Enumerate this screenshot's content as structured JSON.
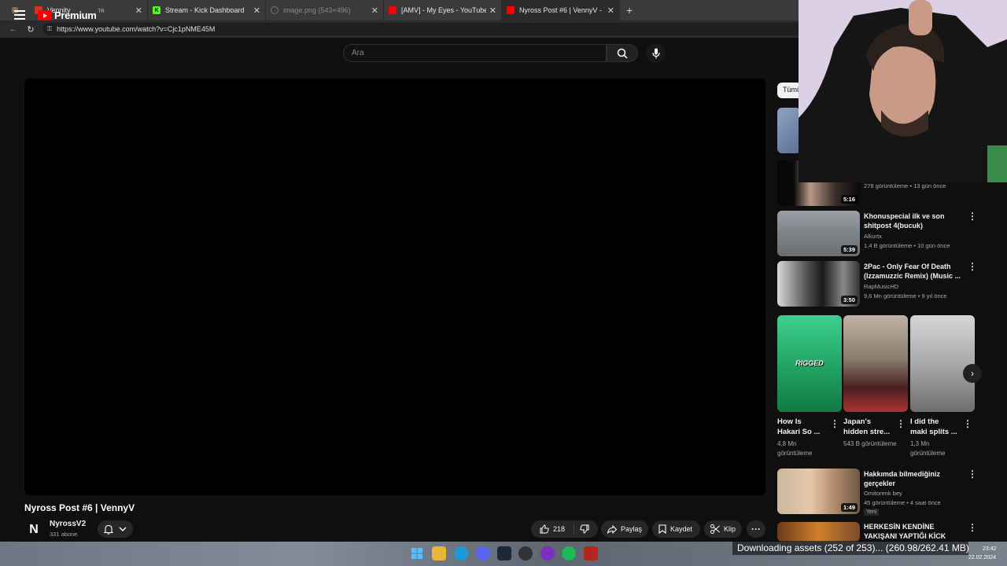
{
  "browser": {
    "tabs": [
      {
        "title": "Vennity",
        "icon": "vennity-icon",
        "color": "#d93025",
        "state": "normal"
      },
      {
        "title": "Stream - Kick Dashboard",
        "icon": "kick-icon",
        "color": "#53fc18",
        "state": "normal"
      },
      {
        "title": "image.png (543×496)",
        "icon": "globe-icon",
        "color": "#777777",
        "state": "dim"
      },
      {
        "title": "[AMV] - My Eyes - YouTube",
        "icon": "youtube-icon",
        "color": "#ff0000",
        "state": "normal"
      },
      {
        "title": "Nyross Post #6 | VennyV - YouTube",
        "icon": "youtube-icon",
        "color": "#ff0000",
        "state": "active"
      }
    ],
    "url": "https://www.youtube.com/watch?v=Cjc1pNME45M"
  },
  "youtube": {
    "logo_text": "Premium",
    "logo_region": "TR",
    "search_placeholder": "Ara"
  },
  "video": {
    "title": "Nyross Post #6 | VennyV",
    "channel": {
      "initial": "N",
      "name": "NyrossV2",
      "subs": "331 abone"
    },
    "likes": "218",
    "share_label": "Paylaş",
    "save_label": "Kaydet",
    "clip_label": "Klip"
  },
  "sidebar": {
    "chip": "Tümü",
    "related": [
      {
        "title": "",
        "meta1": "",
        "meta2": "278 görüntüleme • 13 gün önce",
        "duration": "5:16"
      },
      {
        "title": "Khonuspecial ilk ve son shitpost 4(bucuk)",
        "meta1": "Alkurtx",
        "meta2": "1,4 B görüntüleme • 10 gün önce",
        "duration": "5:39"
      },
      {
        "title": "2Pac - Only Fear Of Death (Izzamuzzic Remix) (Music ...",
        "meta1": "RapMusicHD",
        "meta2": "9,6 Mn görüntüleme • 9 yıl önce",
        "duration": "3:50"
      }
    ],
    "shorts": [
      {
        "title": "How Is Hakari So ...",
        "views": "4,8 Mn görüntüleme",
        "thumb_text": "RIGGED"
      },
      {
        "title": "Japan's hidden stre...",
        "views": "543 B görüntüleme",
        "thumb_text": ""
      },
      {
        "title": "I did the maki splits ...",
        "views": "1,3 Mn görüntüleme",
        "thumb_text": ""
      }
    ],
    "related_lower": [
      {
        "title": "Hakkımda bilmediğiniz gerçekler",
        "meta1": "Omitorenk bey",
        "meta2": "45 görüntüleme • 4 saat önce",
        "badge": "Yeni",
        "duration": "1:49"
      },
      {
        "title": "HERKESİN KENDİNE YAKIŞANI YAPTIĞI KİCK EDİTİ",
        "meta1": "",
        "meta2": "",
        "badge": "",
        "duration": ""
      }
    ]
  },
  "overlay": {
    "download_status": "Downloading assets (252 of 253)... (260.98/262.41 MB)"
  },
  "taskbar": {
    "time": "23:42",
    "date": "22.02.2024"
  }
}
